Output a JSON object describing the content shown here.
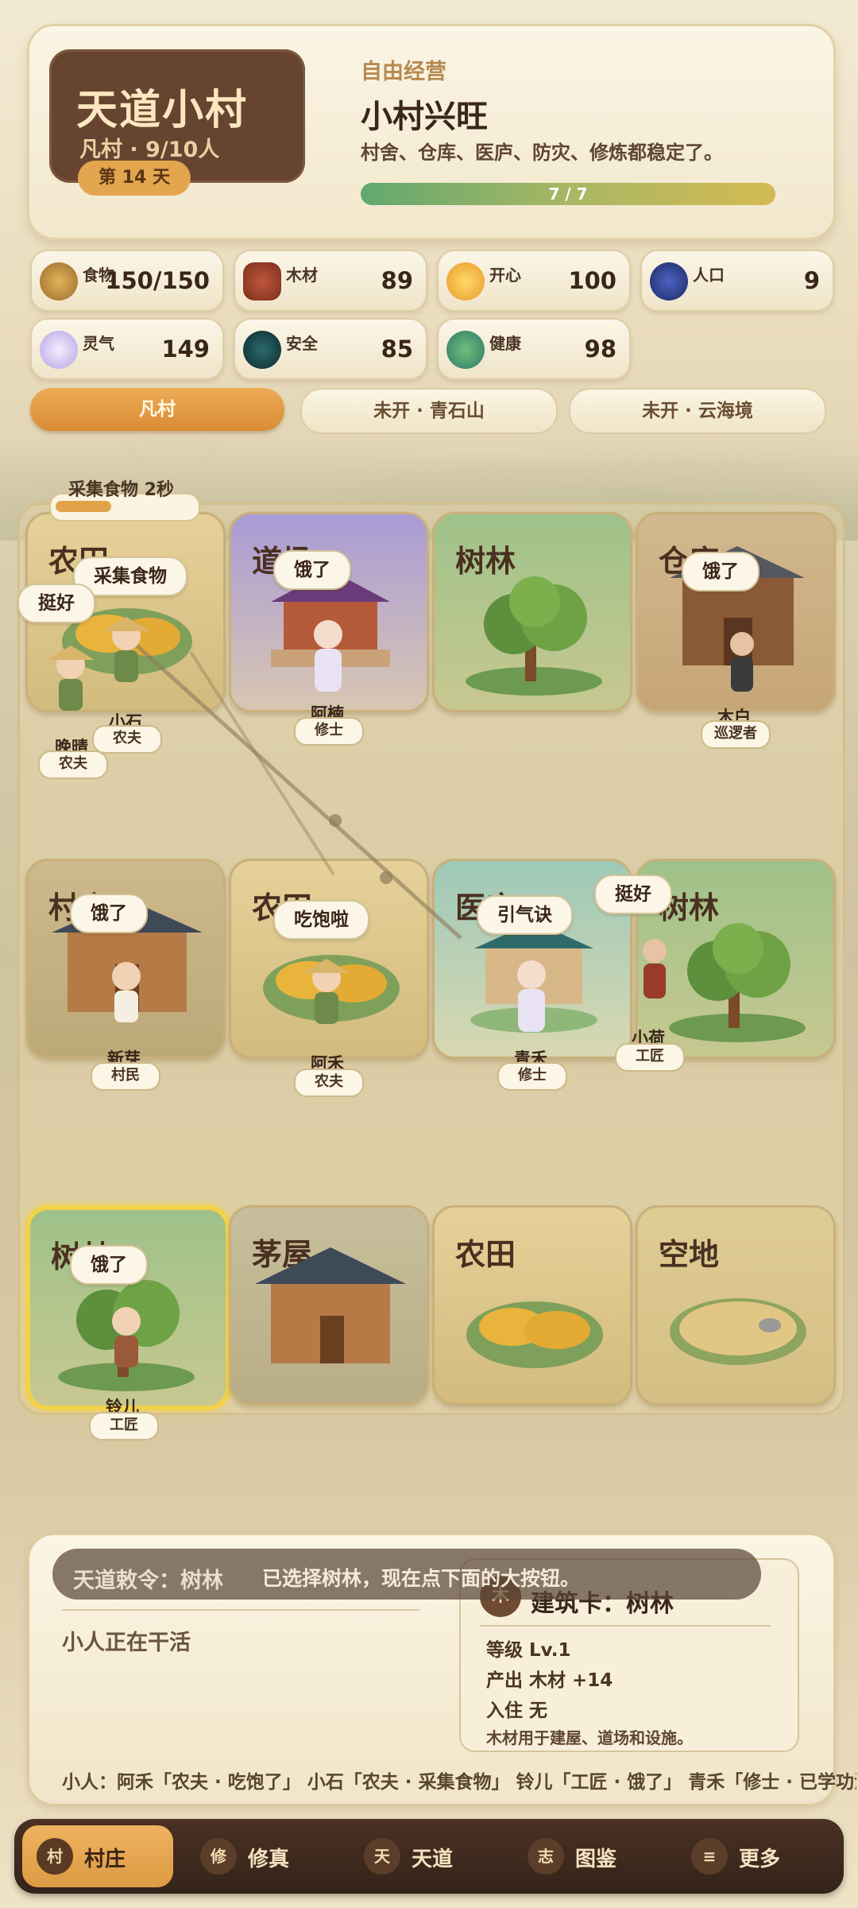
{
  "header": {
    "village_name": "天道小村",
    "village_sub": "凡村 · 9/10人",
    "day": "第 14 天",
    "mode": "自由经营",
    "status_title": "小村兴旺",
    "status_desc": "村舍、仓库、医庐、防灾、修炼都稳定了。",
    "progress_text": "7 / 7",
    "progress_ratio": 1.0
  },
  "resources": [
    {
      "label": "食物",
      "value": "150/150",
      "icon": "wheat-icon"
    },
    {
      "label": "木材",
      "value": "89",
      "icon": "wood-icon"
    },
    {
      "label": "开心",
      "value": "100",
      "icon": "smile-icon"
    },
    {
      "label": "人口",
      "value": "9",
      "icon": "people-icon"
    },
    {
      "label": "灵气",
      "value": "149",
      "icon": "spirit-icon"
    },
    {
      "label": "安全",
      "value": "85",
      "icon": "shield-orb-icon"
    },
    {
      "label": "健康",
      "value": "98",
      "icon": "herb-icon"
    }
  ],
  "tabs": [
    "凡村",
    "未开 · 青石山",
    "未开 · 云海境"
  ],
  "task": {
    "label": "采集食物 2秒",
    "progress": 0.4
  },
  "tiles": [
    {
      "name": "农田",
      "type": "farm"
    },
    {
      "name": "道场",
      "type": "dojo"
    },
    {
      "name": "树林",
      "type": "forest"
    },
    {
      "name": "仓库",
      "type": "barn"
    },
    {
      "name": "村舍",
      "type": "house"
    },
    {
      "name": "农田",
      "type": "farm"
    },
    {
      "name": "医庐",
      "type": "medic"
    },
    {
      "name": "树林",
      "type": "forest"
    },
    {
      "name": "树林",
      "type": "forest"
    },
    {
      "name": "茅屋",
      "type": "hut"
    },
    {
      "name": "农田",
      "type": "farm"
    },
    {
      "name": "空地",
      "type": "empty"
    }
  ],
  "bubbles": [
    "采集食物",
    "挺好",
    "饿了",
    "饿了",
    "饿了",
    "吃饱啦",
    "引气诀",
    "挺好",
    "饿了"
  ],
  "villagers": [
    {
      "name": "小石",
      "role": "农夫"
    },
    {
      "name": "晚晴",
      "role": "农夫"
    },
    {
      "name": "阿楠",
      "role": "修士"
    },
    {
      "name": "木白",
      "role": "巡逻者"
    },
    {
      "name": "新芽",
      "role": "村民"
    },
    {
      "name": "阿禾",
      "role": "农夫"
    },
    {
      "name": "青禾",
      "role": "修士"
    },
    {
      "name": "小荷",
      "role": "工匠"
    },
    {
      "name": "铃儿",
      "role": "工匠"
    }
  ],
  "toast": {
    "title": "天道敕令：树林",
    "message": "已选择树林，现在点下面的大按钮。"
  },
  "working_label": "小人正在干活",
  "building_card": {
    "icon_char": "木",
    "title": "建筑卡：树林",
    "level": "等级  Lv.1",
    "output": "产出  木材 +14",
    "residents": "入住  无",
    "desc": "木材用于建屋、道场和设施。"
  },
  "villager_status_line": "小人：阿禾「农夫 · 吃饱了」 小石「农夫 · 采集食物」 铃儿「工匠 · 饿了」 青禾「修士 · 已学功法」",
  "nav": [
    {
      "icon_char": "村",
      "label": "村庄",
      "active": true
    },
    {
      "icon_char": "修",
      "label": "修真",
      "active": false
    },
    {
      "icon_char": "天",
      "label": "天道",
      "active": false
    },
    {
      "icon_char": "志",
      "label": "图鉴",
      "active": false
    },
    {
      "icon_char": "≡",
      "label": "更多",
      "active": false
    }
  ]
}
